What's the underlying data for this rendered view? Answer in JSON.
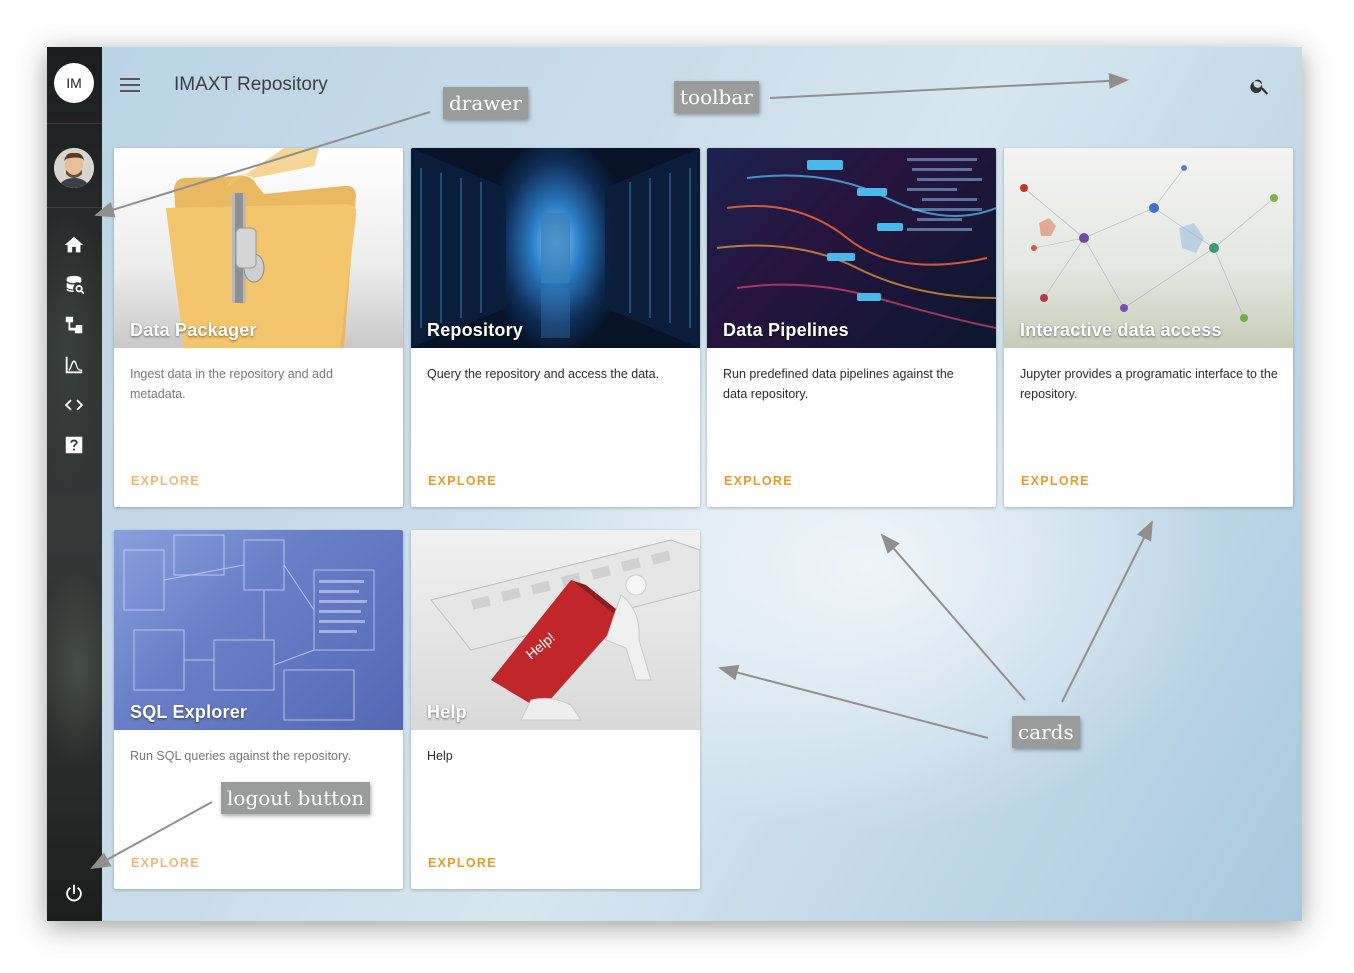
{
  "app": {
    "title": "IMAXT Repository",
    "initials": "IM"
  },
  "drawer": {
    "items": [
      {
        "name": "home",
        "icon": "home-icon"
      },
      {
        "name": "database-search",
        "icon": "database-search-icon"
      },
      {
        "name": "pipelines",
        "icon": "pipeline-icon"
      },
      {
        "name": "analysis",
        "icon": "chart-curve-icon"
      },
      {
        "name": "code",
        "icon": "code-brackets-icon"
      },
      {
        "name": "help",
        "icon": "help-box-icon"
      }
    ],
    "logout_icon": "power-icon"
  },
  "cards": [
    {
      "title": "Data Packager",
      "description": "Ingest data in the repository and add metadata.",
      "action": "EXPLORE"
    },
    {
      "title": "Repository",
      "description": "Query the repository and access the data.",
      "action": "EXPLORE"
    },
    {
      "title": "Data Pipelines",
      "description": "Run predefined data pipelines against the data repository.",
      "action": "EXPLORE"
    },
    {
      "title": "Interactive data access",
      "description": "Jupyter provides a programatic interface to the repository.",
      "action": "EXPLORE"
    },
    {
      "title": "SQL Explorer",
      "description": "Run SQL queries against the repository.",
      "action": "EXPLORE"
    },
    {
      "title": "Help",
      "description": "Help",
      "action": "EXPLORE"
    }
  ],
  "annotations": {
    "drawer": "drawer",
    "toolbar": "toolbar",
    "cards": "cards",
    "logout": "logout button"
  },
  "colors": {
    "accent": "#e59a2a",
    "drawer_bg": "#2c302f",
    "annotation_bg": "#9a9b9b"
  },
  "image_lettering": {
    "help_key": "Help!"
  }
}
